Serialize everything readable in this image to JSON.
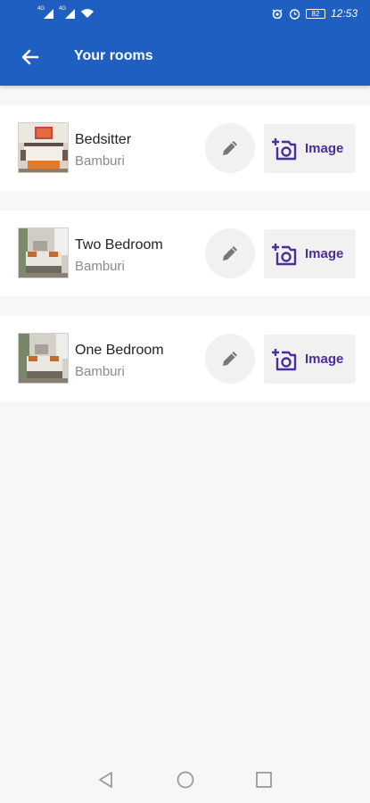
{
  "status_bar": {
    "sim1_tag": "4G",
    "sim2_tag": "4G",
    "battery": "82",
    "time": "12:53",
    "icons": [
      "signal-icon",
      "wifi-icon",
      "eye-icon",
      "alarm-icon",
      "battery-icon"
    ]
  },
  "app_bar": {
    "title": "Your rooms",
    "back_icon": "arrow-left-icon",
    "color": "#1e5fc1"
  },
  "rooms": [
    {
      "name": "Bedsitter",
      "location": "Bamburi",
      "thumbnail": "bedroom-photo",
      "action_label": "Image"
    },
    {
      "name": "Two Bedroom",
      "location": "Bamburi",
      "thumbnail": "bedroom-photo",
      "action_label": "Image"
    },
    {
      "name": "One Bedroom",
      "location": "Bamburi",
      "thumbnail": "bedroom-photo",
      "action_label": "Image"
    }
  ],
  "colors": {
    "accent": "#4a2e9a",
    "background": "#f7f7f7",
    "card": "#ffffff"
  },
  "nav_bar": {
    "icons": [
      "back-triangle-icon",
      "home-circle-icon",
      "recents-square-icon"
    ]
  }
}
